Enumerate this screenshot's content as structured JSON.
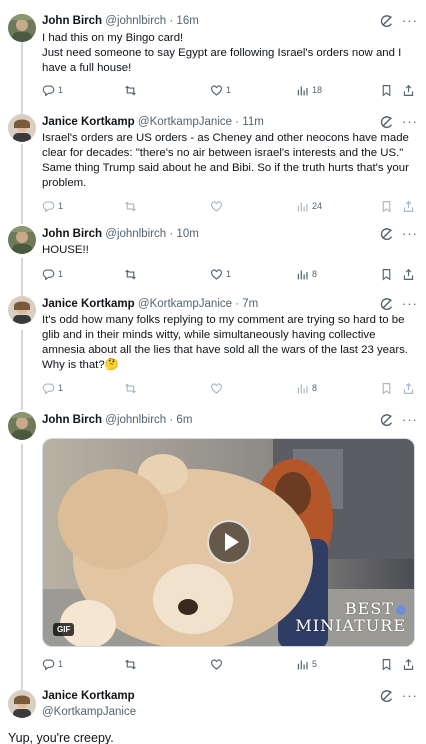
{
  "tweets": [
    {
      "name": "John Birch",
      "handle": "@johnlbirch",
      "time": "16m",
      "text": [
        "I had this on my Bingo card!",
        "Just need someone to say Egypt are following Israel's orders now and I have a full house!"
      ],
      "replies": "1",
      "reposts": "",
      "likes": "1",
      "views": "18",
      "avatar": "john-avatar"
    },
    {
      "name": "Janice Kortkamp",
      "handle": "@KortkampJanice",
      "time": "11m",
      "text": [
        "Israel's orders are US orders - as Cheney and other neocons have made clear for decades: \"there's no air between israel's interests and the US.\" Same thing Trump said about he and Bibi. So if the truth hurts that's your problem."
      ],
      "replies": "1",
      "reposts": "",
      "likes": "",
      "views": "24",
      "avatar": "janice-avatar"
    },
    {
      "name": "John Birch",
      "handle": "@johnlbirch",
      "time": "10m",
      "text": [
        "HOUSE!!"
      ],
      "replies": "1",
      "reposts": "",
      "likes": "1",
      "views": "8",
      "avatar": "john-avatar"
    },
    {
      "name": "Janice Kortkamp",
      "handle": "@KortkampJanice",
      "time": "7m",
      "text": [
        "It's odd how many folks replying to my comment are trying so hard to be glib and in their minds witty, while simultaneously having collective amnesia about all the lies that have sold all the wars of the last 23 years. Why is that?🤔"
      ],
      "replies": "1",
      "reposts": "",
      "likes": "",
      "views": "8",
      "avatar": "janice-avatar"
    },
    {
      "name": "John Birch",
      "handle": "@johnlbirch",
      "time": "6m",
      "text": [],
      "replies": "1",
      "reposts": "",
      "likes": "",
      "views": "5",
      "avatar": "john-avatar",
      "media": {
        "badge": "GIF",
        "watermark_line1": "BEST",
        "watermark_line2": "MINIATURE",
        "icon": "play-icon"
      }
    }
  ],
  "focused_tweet": {
    "name": "Janice Kortkamp",
    "handle": "@KortkampJanice",
    "text": "Yup, you're creepy."
  },
  "icons": {
    "reply": "reply-icon",
    "repost": "repost-icon",
    "like": "like-icon",
    "views": "views-icon",
    "bookmark": "bookmark-icon",
    "share": "share-icon",
    "grok": "grok-icon",
    "more": "more-icon"
  },
  "colors": {
    "text": "#0f1419",
    "secondary": "#536471",
    "divider": "#eff3f4",
    "thread_line": "#cfd9de"
  }
}
